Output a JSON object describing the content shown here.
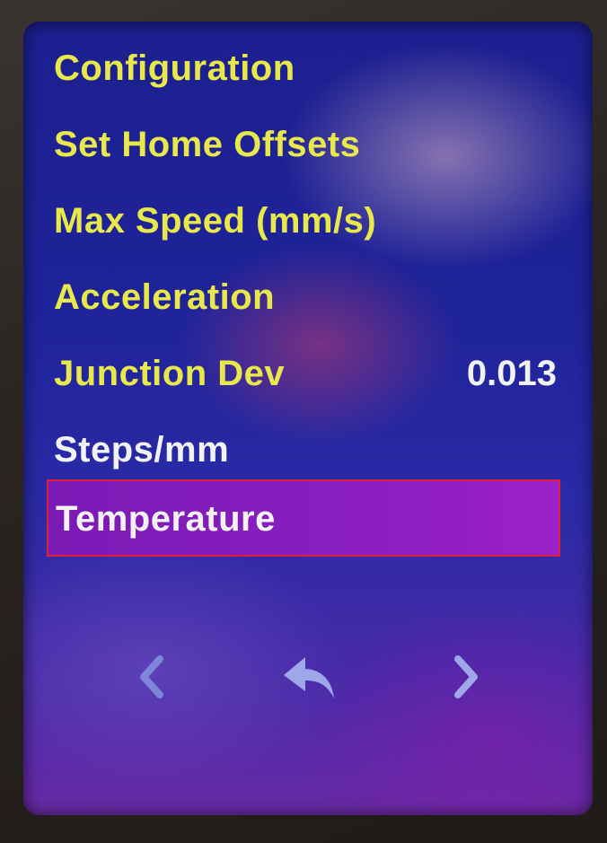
{
  "menu": {
    "items": [
      {
        "label": "Configuration"
      },
      {
        "label": "Set Home Offsets"
      },
      {
        "label": "Max Speed (mm/s)"
      },
      {
        "label": "Acceleration"
      },
      {
        "label": "Junction Dev",
        "value": "0.013"
      },
      {
        "label": "Steps/mm"
      },
      {
        "label": "Temperature"
      }
    ],
    "selected_label": "Temperature"
  },
  "nav": {
    "prev_icon": "chevron-left-icon",
    "back_icon": "return-arrow-icon",
    "next_icon": "chevron-right-icon"
  },
  "colors": {
    "menu_text": "#e8e84a",
    "value_text": "#f2f2f2",
    "selection_fill": "#8a1ec0",
    "selection_border": "#e0203a",
    "screen_background": "#1e2399"
  }
}
